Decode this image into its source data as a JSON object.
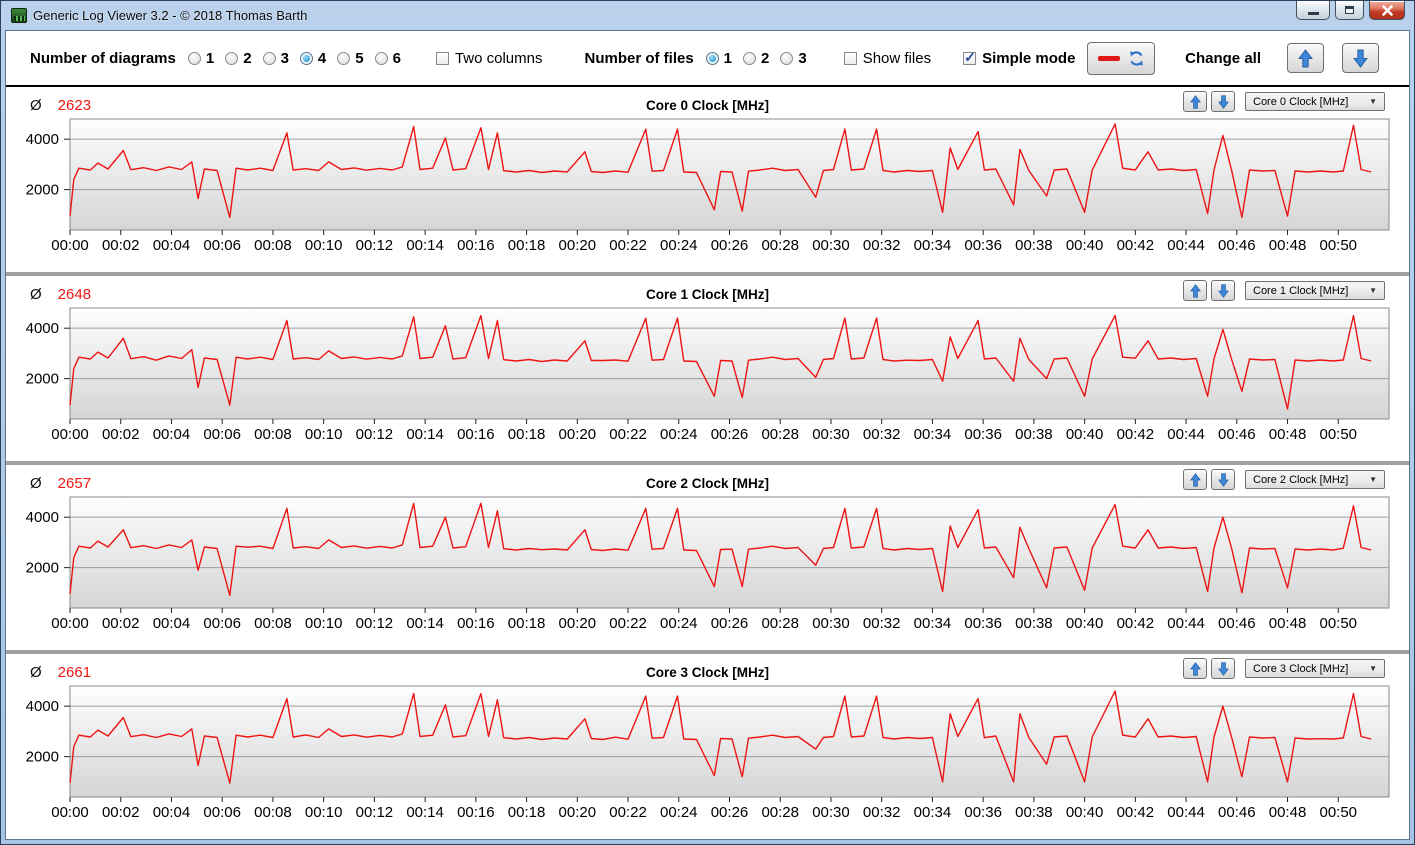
{
  "window": {
    "title": "Generic Log Viewer 3.2 - © 2018 Thomas Barth"
  },
  "icons": {
    "combo_arrow": "▼",
    "check": "✓"
  },
  "toolbar": {
    "diagrams": {
      "label": "Number of diagrams",
      "options": [
        "1",
        "2",
        "3",
        "4",
        "5",
        "6"
      ],
      "selected": "4"
    },
    "two_columns": {
      "label": "Two columns",
      "checked": false
    },
    "files": {
      "label": "Number of files",
      "options": [
        "1",
        "2",
        "3"
      ],
      "selected": "1"
    },
    "show_files": {
      "label": "Show files",
      "checked": false
    },
    "simple_mode": {
      "label": "Simple mode",
      "checked": true
    },
    "change_all": {
      "label": "Change all"
    }
  },
  "chart_data": {
    "type": "line",
    "avg_symbol": "Ø",
    "line_color": "#ee1414",
    "grid_color": "#9c9c9c",
    "xlim_minutes": [
      0,
      52
    ],
    "ylim": [
      400,
      4800
    ],
    "y_ticks": [
      2000,
      4000
    ],
    "x_ticks": [
      "00:00",
      "00:02",
      "00:04",
      "00:06",
      "00:08",
      "00:10",
      "00:12",
      "00:14",
      "00:16",
      "00:18",
      "00:20",
      "00:22",
      "00:24",
      "00:26",
      "00:28",
      "00:30",
      "00:32",
      "00:34",
      "00:36",
      "00:38",
      "00:40",
      "00:42",
      "00:44",
      "00:46",
      "00:48",
      "00:50"
    ],
    "charts": [
      {
        "title": "Core 0 Clock [MHz]",
        "average": "2623",
        "dropdown": "Core 0 Clock [MHz]",
        "points": [
          0,
          950,
          0.15,
          2400,
          0.35,
          2850,
          0.8,
          2780,
          1.1,
          3050,
          1.5,
          2820,
          2.1,
          3550,
          2.4,
          2790,
          2.9,
          2870,
          3.4,
          2760,
          3.9,
          2900,
          4.4,
          2800,
          4.8,
          3100,
          5.05,
          1650,
          5.3,
          2820,
          5.8,
          2760,
          6.3,
          900,
          6.55,
          2850,
          7,
          2780,
          7.5,
          2850,
          8,
          2760,
          8.55,
          4250,
          8.8,
          2780,
          9.3,
          2830,
          9.8,
          2760,
          10.2,
          3100,
          10.7,
          2800,
          11.2,
          2860,
          11.7,
          2770,
          12.2,
          2840,
          12.7,
          2780,
          13.1,
          2900,
          13.55,
          4500,
          13.8,
          2800,
          14.3,
          2850,
          14.8,
          4050,
          15.1,
          2780,
          15.6,
          2830,
          16.2,
          4450,
          16.5,
          2800,
          16.85,
          4250,
          17.1,
          2750,
          17.6,
          2700,
          18.1,
          2760,
          18.6,
          2680,
          19.1,
          2740,
          19.6,
          2700,
          20.3,
          3500,
          20.55,
          2720,
          21,
          2680,
          21.5,
          2740,
          22,
          2690,
          22.7,
          4400,
          22.95,
          2730,
          23.4,
          2760,
          23.95,
          4400,
          24.2,
          2700,
          24.7,
          2680,
          25.4,
          1200,
          25.65,
          2720,
          26.1,
          2700,
          26.5,
          1150,
          26.75,
          2730,
          27.2,
          2780,
          27.7,
          2850,
          28.2,
          2760,
          28.7,
          2800,
          29.4,
          1700,
          29.7,
          2760,
          30.1,
          2800,
          30.55,
          4400,
          30.8,
          2780,
          31.3,
          2820,
          31.8,
          4400,
          32.05,
          2760,
          32.5,
          2700,
          33,
          2760,
          33.5,
          2720,
          34,
          2760,
          34.4,
          1100,
          34.7,
          3650,
          35,
          2800,
          35.8,
          4300,
          36.05,
          2780,
          36.5,
          2820,
          37.2,
          1400,
          37.45,
          3600,
          37.8,
          2760,
          38.5,
          1750,
          38.8,
          2780,
          39.3,
          2820,
          40,
          1100,
          40.3,
          2780,
          41.2,
          4600,
          41.5,
          2850,
          42,
          2780,
          42.5,
          3500,
          42.9,
          2780,
          43.4,
          2820,
          43.9,
          2760,
          44.4,
          2800,
          44.85,
          1050,
          45.1,
          2780,
          45.45,
          4150,
          45.8,
          2750,
          46.2,
          900,
          46.5,
          2780,
          47,
          2740,
          47.5,
          2760,
          48,
          950,
          48.3,
          2740,
          48.8,
          2700,
          49.3,
          2740,
          49.8,
          2700,
          50.2,
          2740,
          50.6,
          4550,
          50.9,
          2800,
          51.3,
          2700
        ]
      },
      {
        "title": "Core 1 Clock [MHz]",
        "average": "2648",
        "dropdown": "Core 1 Clock [MHz]",
        "points": [
          0,
          950,
          0.15,
          2400,
          0.35,
          2850,
          0.8,
          2780,
          1.1,
          3050,
          1.5,
          2820,
          2.1,
          3600,
          2.4,
          2790,
          2.9,
          2870,
          3.4,
          2730,
          3.9,
          2900,
          4.4,
          2800,
          4.8,
          3150,
          5.05,
          1650,
          5.3,
          2820,
          5.8,
          2760,
          6.3,
          950,
          6.55,
          2850,
          7,
          2780,
          7.5,
          2850,
          8,
          2760,
          8.55,
          4300,
          8.8,
          2780,
          9.3,
          2830,
          9.8,
          2760,
          10.2,
          3100,
          10.7,
          2800,
          11.2,
          2860,
          11.7,
          2770,
          12.2,
          2840,
          12.7,
          2780,
          13.1,
          2900,
          13.55,
          4450,
          13.8,
          2800,
          14.3,
          2850,
          14.8,
          4100,
          15.1,
          2780,
          15.6,
          2830,
          16.2,
          4500,
          16.5,
          2800,
          16.85,
          4300,
          17.1,
          2750,
          17.6,
          2700,
          18.1,
          2760,
          18.6,
          2680,
          19.1,
          2740,
          19.6,
          2700,
          20.3,
          3500,
          20.55,
          2720,
          21,
          2720,
          21.5,
          2740,
          22,
          2690,
          22.7,
          4400,
          22.95,
          2730,
          23.4,
          2760,
          23.95,
          4400,
          24.2,
          2700,
          24.7,
          2680,
          25.4,
          1300,
          25.65,
          2720,
          26.1,
          2700,
          26.5,
          1250,
          26.75,
          2730,
          27.2,
          2780,
          27.7,
          2850,
          28.2,
          2760,
          28.7,
          2800,
          29.4,
          2050,
          29.7,
          2760,
          30.1,
          2800,
          30.55,
          4400,
          30.8,
          2780,
          31.3,
          2820,
          31.8,
          4400,
          32.05,
          2760,
          32.5,
          2700,
          33,
          2730,
          33.5,
          2720,
          34,
          2760,
          34.4,
          1900,
          34.7,
          3650,
          35,
          2800,
          35.8,
          4300,
          36.05,
          2780,
          36.5,
          2820,
          37.2,
          1900,
          37.45,
          3600,
          37.8,
          2760,
          38.5,
          2000,
          38.8,
          2780,
          39.3,
          2820,
          40,
          1300,
          40.3,
          2780,
          41.2,
          4500,
          41.5,
          2850,
          42,
          2810,
          42.5,
          3500,
          42.9,
          2780,
          43.4,
          2820,
          43.9,
          2760,
          44.4,
          2800,
          44.85,
          1300,
          45.1,
          2780,
          45.45,
          3950,
          45.8,
          2750,
          46.2,
          1500,
          46.5,
          2780,
          47,
          2740,
          47.5,
          2760,
          48,
          800,
          48.3,
          2740,
          48.8,
          2700,
          49.3,
          2740,
          49.8,
          2700,
          50.2,
          2740,
          50.6,
          4500,
          50.9,
          2800,
          51.3,
          2700
        ]
      },
      {
        "title": "Core 2 Clock [MHz]",
        "average": "2657",
        "dropdown": "Core 2 Clock [MHz]",
        "points": [
          0,
          950,
          0.15,
          2400,
          0.35,
          2850,
          0.8,
          2780,
          1.1,
          3050,
          1.5,
          2820,
          2.1,
          3500,
          2.4,
          2790,
          2.9,
          2870,
          3.4,
          2760,
          3.9,
          2900,
          4.4,
          2800,
          4.8,
          3100,
          5.05,
          1900,
          5.3,
          2820,
          5.8,
          2760,
          6.3,
          900,
          6.55,
          2850,
          7,
          2810,
          7.5,
          2850,
          8,
          2760,
          8.55,
          4350,
          8.8,
          2780,
          9.3,
          2830,
          9.8,
          2760,
          10.2,
          3100,
          10.7,
          2800,
          11.2,
          2860,
          11.7,
          2770,
          12.2,
          2840,
          12.7,
          2780,
          13.1,
          2900,
          13.55,
          4550,
          13.8,
          2800,
          14.3,
          2850,
          14.8,
          4000,
          15.1,
          2780,
          15.6,
          2830,
          16.2,
          4550,
          16.5,
          2800,
          16.85,
          4250,
          17.1,
          2750,
          17.6,
          2700,
          18.1,
          2760,
          18.6,
          2710,
          19.1,
          2740,
          19.6,
          2700,
          20.3,
          3500,
          20.55,
          2720,
          21,
          2680,
          21.5,
          2740,
          22,
          2690,
          22.7,
          4350,
          22.95,
          2730,
          23.4,
          2760,
          23.95,
          4350,
          24.2,
          2700,
          24.7,
          2680,
          25.4,
          1250,
          25.65,
          2720,
          26.1,
          2730,
          26.5,
          1250,
          26.75,
          2730,
          27.2,
          2780,
          27.7,
          2850,
          28.2,
          2760,
          28.7,
          2800,
          29.4,
          2100,
          29.7,
          2760,
          30.1,
          2800,
          30.55,
          4350,
          30.8,
          2780,
          31.3,
          2820,
          31.8,
          4350,
          32.05,
          2760,
          32.5,
          2700,
          33,
          2760,
          33.5,
          2720,
          34,
          2760,
          34.4,
          1050,
          34.7,
          3650,
          35,
          2800,
          35.8,
          4300,
          36.05,
          2780,
          36.5,
          2820,
          37.2,
          1600,
          37.45,
          3600,
          37.8,
          2760,
          38.5,
          1200,
          38.8,
          2780,
          39.3,
          2820,
          40,
          1100,
          40.3,
          2780,
          41.2,
          4500,
          41.5,
          2850,
          42,
          2780,
          42.5,
          3500,
          42.9,
          2780,
          43.4,
          2820,
          43.9,
          2760,
          44.4,
          2800,
          44.85,
          1050,
          45.1,
          2780,
          45.45,
          4000,
          45.8,
          2750,
          46.2,
          1000,
          46.5,
          2780,
          47,
          2740,
          47.5,
          2760,
          48,
          1200,
          48.3,
          2740,
          48.8,
          2700,
          49.3,
          2740,
          49.8,
          2700,
          50.2,
          2770,
          50.6,
          4450,
          50.9,
          2800,
          51.3,
          2700
        ]
      },
      {
        "title": "Core 3 Clock [MHz]",
        "average": "2661",
        "dropdown": "Core 3 Clock [MHz]",
        "points": [
          0,
          950,
          0.15,
          2400,
          0.35,
          2850,
          0.8,
          2780,
          1.1,
          3050,
          1.5,
          2820,
          2.1,
          3550,
          2.4,
          2790,
          2.9,
          2870,
          3.4,
          2760,
          3.9,
          2900,
          4.4,
          2800,
          4.8,
          3100,
          5.05,
          1650,
          5.3,
          2820,
          5.8,
          2760,
          6.3,
          950,
          6.55,
          2850,
          7,
          2780,
          7.5,
          2850,
          8,
          2760,
          8.55,
          4300,
          8.8,
          2780,
          9.3,
          2860,
          9.8,
          2760,
          10.2,
          3100,
          10.7,
          2800,
          11.2,
          2860,
          11.7,
          2770,
          12.2,
          2840,
          12.7,
          2780,
          13.1,
          2900,
          13.55,
          4500,
          13.8,
          2800,
          14.3,
          2850,
          14.8,
          4050,
          15.1,
          2780,
          15.6,
          2830,
          16.2,
          4500,
          16.5,
          2800,
          16.85,
          4250,
          17.1,
          2750,
          17.6,
          2700,
          18.1,
          2760,
          18.6,
          2680,
          19.1,
          2740,
          19.6,
          2700,
          20.3,
          3500,
          20.55,
          2720,
          21,
          2680,
          21.5,
          2770,
          22,
          2690,
          22.7,
          4400,
          22.95,
          2730,
          23.4,
          2760,
          23.95,
          4400,
          24.2,
          2700,
          24.7,
          2680,
          25.4,
          1250,
          25.65,
          2720,
          26.1,
          2700,
          26.5,
          1200,
          26.75,
          2730,
          27.2,
          2780,
          27.7,
          2850,
          28.2,
          2760,
          28.7,
          2800,
          29.4,
          2300,
          29.7,
          2760,
          30.1,
          2800,
          30.55,
          4400,
          30.8,
          2780,
          31.3,
          2820,
          31.8,
          4400,
          32.05,
          2760,
          32.5,
          2700,
          33,
          2760,
          33.5,
          2720,
          34,
          2760,
          34.4,
          1000,
          34.7,
          3700,
          35,
          2800,
          35.8,
          4300,
          36.05,
          2750,
          36.5,
          2820,
          37.2,
          1000,
          37.45,
          3700,
          37.8,
          2760,
          38.5,
          1700,
          38.8,
          2780,
          39.3,
          2820,
          40,
          1000,
          40.3,
          2780,
          41.2,
          4600,
          41.5,
          2850,
          42,
          2780,
          42.5,
          3500,
          42.9,
          2780,
          43.4,
          2820,
          43.9,
          2760,
          44.4,
          2800,
          44.85,
          1000,
          45.1,
          2780,
          45.45,
          4000,
          45.8,
          2750,
          46.2,
          1200,
          46.5,
          2780,
          47,
          2740,
          47.5,
          2760,
          48,
          1000,
          48.3,
          2740,
          48.8,
          2700,
          49.3,
          2710,
          49.8,
          2700,
          50.2,
          2740,
          50.6,
          4500,
          50.9,
          2800,
          51.3,
          2700
        ]
      }
    ]
  }
}
